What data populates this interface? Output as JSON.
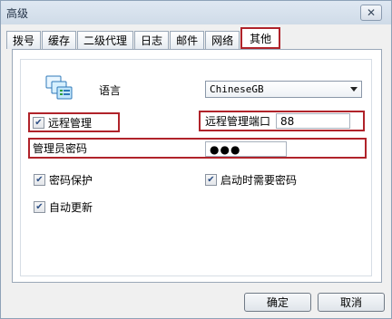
{
  "window": {
    "title": "高级"
  },
  "tabs": [
    {
      "label": "拨号"
    },
    {
      "label": "缓存"
    },
    {
      "label": "二级代理"
    },
    {
      "label": "日志"
    },
    {
      "label": "邮件"
    },
    {
      "label": "网络"
    },
    {
      "label": "其他"
    }
  ],
  "active_tab": "其他",
  "language": {
    "label": "语言",
    "selected": "ChineseGB"
  },
  "remote_management": {
    "label": "远程管理",
    "checked": true
  },
  "remote_port": {
    "label": "远程管理端口",
    "value": "88"
  },
  "admin_password": {
    "label": "管理员密码",
    "value": "●●●"
  },
  "password_protection": {
    "label": "密码保护",
    "checked": true
  },
  "startup_password": {
    "label": "启动时需要密码",
    "checked": true
  },
  "auto_update": {
    "label": "自动更新",
    "checked": true
  },
  "buttons": {
    "ok": "确定",
    "cancel": "取消"
  },
  "colors": {
    "highlight_box": "#b0232a",
    "titlebar": "#cfdbe8",
    "check": "#2d4f85"
  }
}
